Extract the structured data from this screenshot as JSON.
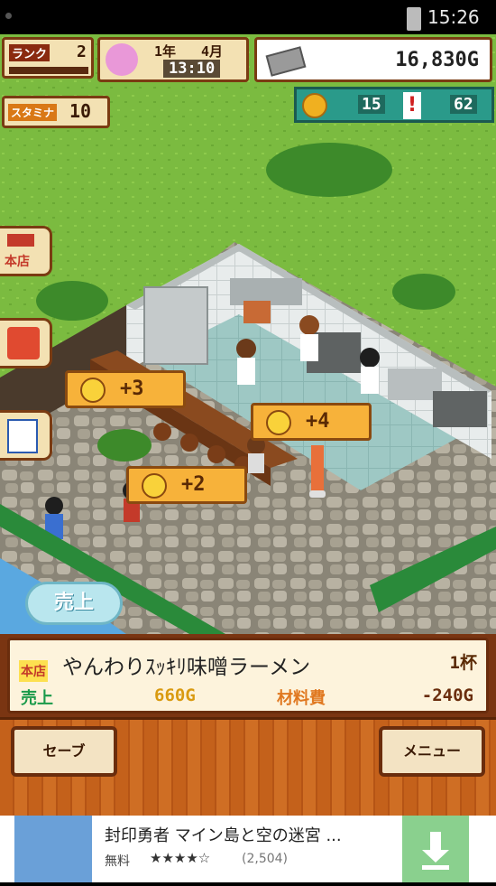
{
  "status_bar": {
    "time": "15:26"
  },
  "hud": {
    "rank_label": "ランク",
    "rank_value": "2",
    "date_year": "1年",
    "date_month": "4月",
    "clock": "13:10",
    "money": "16,830G",
    "stamina_label": "スタミナ",
    "stamina_value": "10",
    "coins": "15",
    "popularity": "62"
  },
  "side_buttons": [
    {
      "icon": "shop-icon",
      "label": "本店"
    },
    {
      "icon": "staff-icon",
      "label": ""
    },
    {
      "icon": "menu-list-icon",
      "label": ""
    }
  ],
  "speech_bubbles": [
    "+3",
    "+4",
    "+2"
  ],
  "sales_button": "売上",
  "info_panel": {
    "badge": "本店",
    "dish_name": "やんわりｽｯｷﾘ味噌ラーメン",
    "count": "1杯",
    "sales_label": "売上",
    "sales_value": "660G",
    "cost_label": "材料費",
    "cost_value": "-240G"
  },
  "buttons": {
    "save": "セーブ",
    "menu": "メニュー"
  },
  "ad": {
    "title": "封印勇者 マイン島と空の迷宮 ...",
    "price": "無料",
    "stars": "★★★★☆",
    "reviews": "(2,504)"
  },
  "colors": {
    "grass": "#79b83e",
    "panel_border": "#7a3b12",
    "panel_bg": "#f3e1b3",
    "wood": "#c4611b",
    "accent_teal": "#2a9a8a"
  }
}
